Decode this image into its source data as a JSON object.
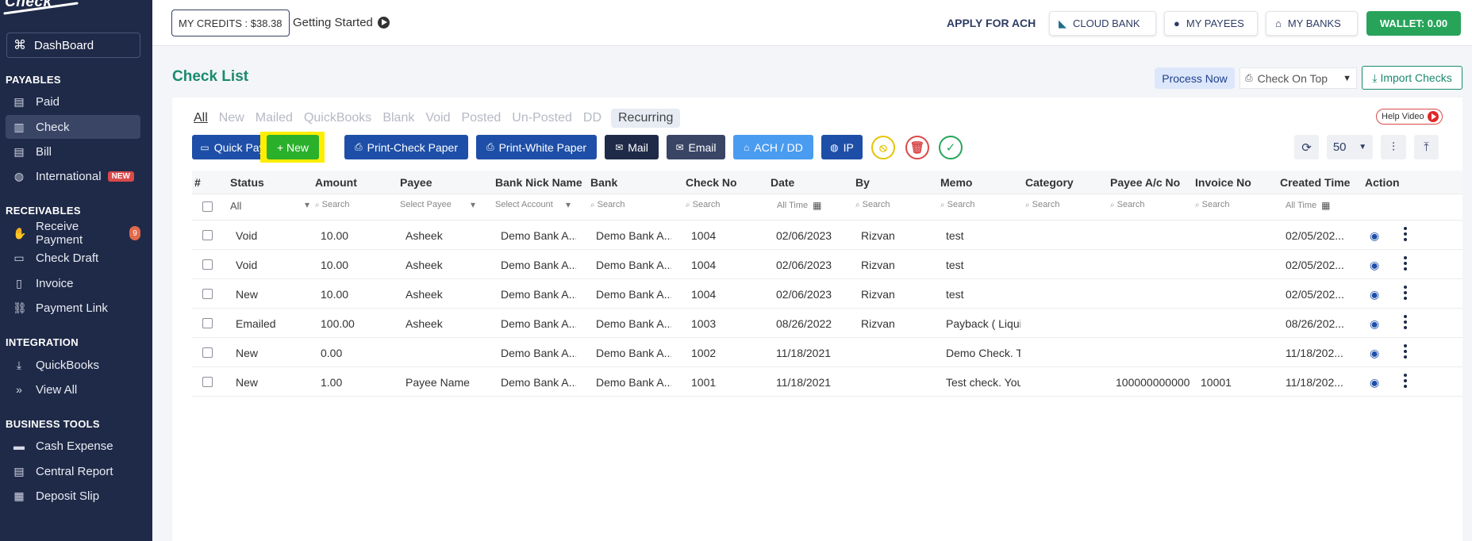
{
  "sidebar": {
    "logo": "Check",
    "dashboard": "DashBoard",
    "sections": {
      "payables": "PAYABLES",
      "receivables": "RECEIVABLES",
      "integration": "INTEGRATION",
      "business_tools": "BUSINESS TOOLS"
    },
    "items": {
      "paid": "Paid",
      "check": "Check",
      "bill": "Bill",
      "international": "International",
      "international_badge": "NEW",
      "receive_payment": "Receive Payment",
      "receive_payment_count": "9",
      "check_draft": "Check Draft",
      "invoice": "Invoice",
      "payment_link": "Payment Link",
      "quickbooks": "QuickBooks",
      "view_all": "View All",
      "cash_expense": "Cash Expense",
      "central_report": "Central Report",
      "deposit_slip": "Deposit Slip"
    }
  },
  "topbar": {
    "credits": "MY CREDITS : $38.38",
    "getting_started": "Getting Started",
    "apply_ach": "APPLY FOR ACH",
    "cloud_bank": "CLOUD BANK",
    "my_payees": "MY PAYEES",
    "my_banks": "MY BANKS",
    "wallet": "WALLET: 0.00"
  },
  "header": {
    "title": "Check List",
    "process_now": "Process Now",
    "sort_select": "Check On Top",
    "import_checks": "Import Checks"
  },
  "tabs": {
    "all": "All",
    "new": "New",
    "mailed": "Mailed",
    "quickbooks": "QuickBooks",
    "blank": "Blank",
    "void": "Void",
    "posted": "Posted",
    "unposted": "Un-Posted",
    "dd": "DD",
    "recurring": "Recurring"
  },
  "help_video": "Help Video",
  "actions": {
    "quick_pay": "Quick Pay",
    "new": "+ New",
    "print_check": "Print-Check Paper",
    "print_white": "Print-White Paper",
    "mail": "Mail",
    "email": "Email",
    "ach_dd": "ACH / DD",
    "ip": "IP",
    "page_size": "50"
  },
  "table": {
    "columns": {
      "num": "#",
      "status": "Status",
      "amount": "Amount",
      "payee": "Payee",
      "bank_nick": "Bank Nick Name",
      "bank": "Bank",
      "check_no": "Check No",
      "date": "Date",
      "by": "By",
      "memo": "Memo",
      "category": "Category",
      "payee_ac": "Payee A/c No",
      "invoice_no": "Invoice No",
      "created": "Created Time",
      "action": "Action"
    },
    "filters": {
      "status": "All",
      "search": "Search",
      "payee": "Select Payee",
      "bank_nick": "Select Account",
      "date": "All Time",
      "created": "All Time"
    },
    "rows": [
      {
        "status": "Void",
        "amount": "10.00",
        "payee": "Asheek",
        "bank_nick": "Demo Bank A...",
        "bank": "Demo Bank A...",
        "check_no": "1004",
        "date": "02/06/2023",
        "by": "Rizvan",
        "memo": "test",
        "category": "",
        "payee_ac": "",
        "invoice_no": "",
        "created": "02/05/202..."
      },
      {
        "status": "Void",
        "amount": "10.00",
        "payee": "Asheek",
        "bank_nick": "Demo Bank A...",
        "bank": "Demo Bank A...",
        "check_no": "1004",
        "date": "02/06/2023",
        "by": "Rizvan",
        "memo": "test",
        "category": "",
        "payee_ac": "",
        "invoice_no": "",
        "created": "02/05/202..."
      },
      {
        "status": "New",
        "amount": "10.00",
        "payee": "Asheek",
        "bank_nick": "Demo Bank A...",
        "bank": "Demo Bank A...",
        "check_no": "1004",
        "date": "02/06/2023",
        "by": "Rizvan",
        "memo": "test",
        "category": "",
        "payee_ac": "",
        "invoice_no": "",
        "created": "02/05/202..."
      },
      {
        "status": "Emailed",
        "amount": "100.00",
        "payee": "Asheek",
        "bank_nick": "Demo Bank A...",
        "bank": "Demo Bank A...",
        "check_no": "1003",
        "date": "08/26/2022",
        "by": "Rizvan",
        "memo": "Payback ( Liqui",
        "category": "",
        "payee_ac": "",
        "invoice_no": "",
        "created": "08/26/202..."
      },
      {
        "status": "New",
        "amount": "0.00",
        "payee": "",
        "bank_nick": "Demo Bank A...",
        "bank": "Demo Bank A...",
        "check_no": "1002",
        "date": "11/18/2021",
        "by": "",
        "memo": "Demo Check. T",
        "category": "",
        "payee_ac": "",
        "invoice_no": "",
        "created": "11/18/202..."
      },
      {
        "status": "New",
        "amount": "1.00",
        "payee": "Payee Name",
        "bank_nick": "Demo Bank A...",
        "bank": "Demo Bank A...",
        "check_no": "1001",
        "date": "11/18/2021",
        "by": "",
        "memo": "Test check. You",
        "category": "",
        "payee_ac": "100000000000",
        "invoice_no": "10001",
        "created": "11/18/202..."
      }
    ]
  }
}
